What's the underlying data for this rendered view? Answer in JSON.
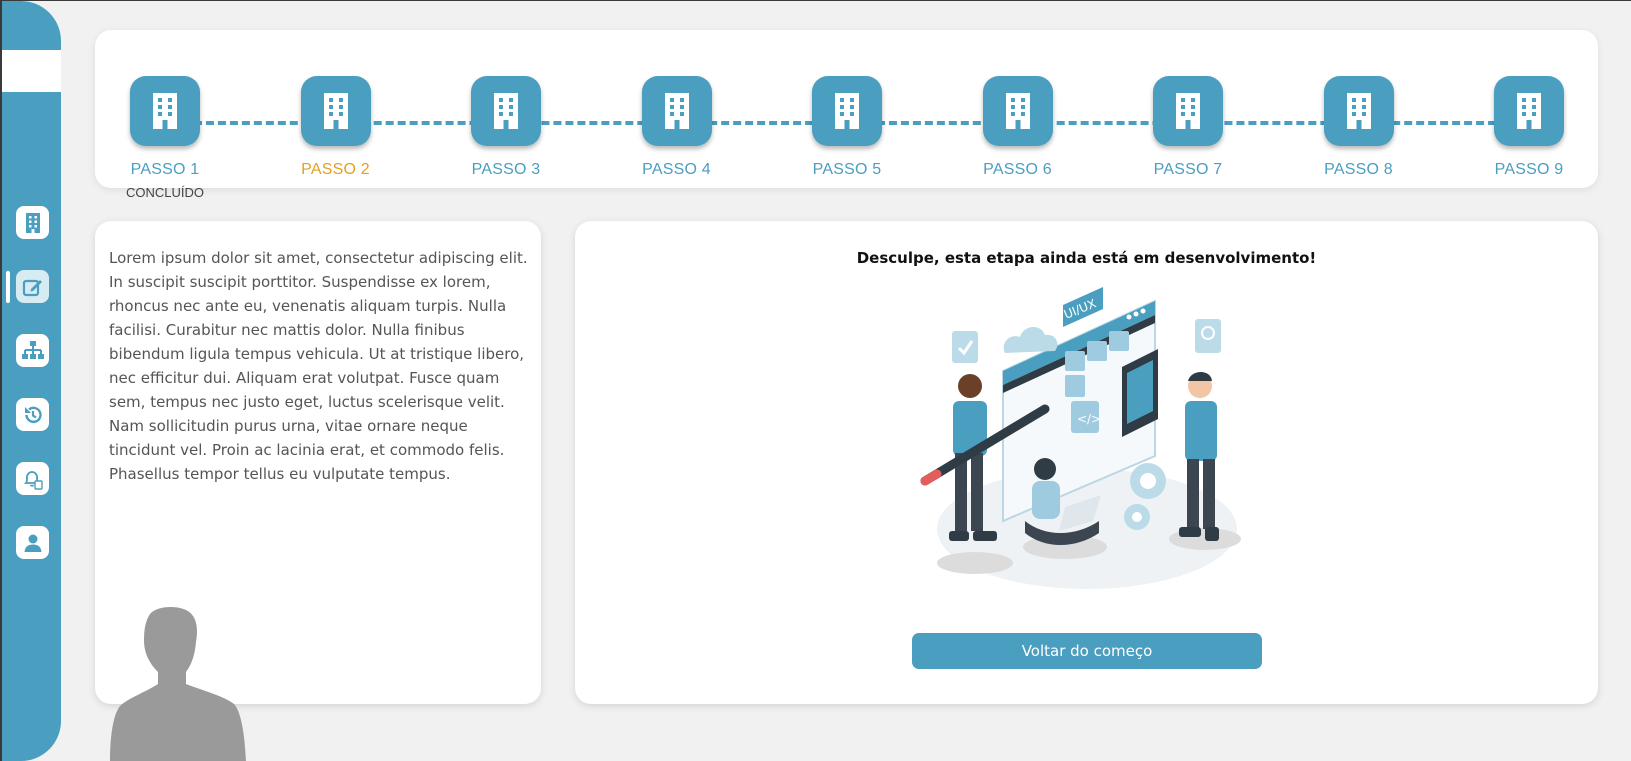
{
  "sidebar": {
    "items": [
      {
        "icon": "building-icon"
      },
      {
        "icon": "edit-icon",
        "active": true
      },
      {
        "icon": "org-chart-icon"
      },
      {
        "icon": "history-icon"
      },
      {
        "icon": "bell-document-icon"
      },
      {
        "icon": "user-icon"
      }
    ]
  },
  "stepper": {
    "steps": [
      {
        "label": "PASSO 1",
        "status": "CONCLUÍDO"
      },
      {
        "label": "PASSO 2",
        "current": true
      },
      {
        "label": "PASSO 3"
      },
      {
        "label": "PASSO 4"
      },
      {
        "label": "PASSO 5"
      },
      {
        "label": "PASSO 6"
      },
      {
        "label": "PASSO 7"
      },
      {
        "label": "PASSO 8"
      },
      {
        "label": "PASSO 9"
      }
    ]
  },
  "info_panel": {
    "text": "Lorem ipsum dolor sit amet, consectetur adipiscing elit. In suscipit suscipit porttitor. Suspendisse ex lorem, rhoncus nec ante eu, venenatis aliquam turpis. Nulla facilisi. Curabitur nec mattis dolor. Nulla finibus bibendum ligula tempus vehicula. Ut at tristique libero, nec efficitur dui. Aliquam erat volutpat. Fusce quam sem, tempus nec justo eget, luctus scelerisque velit. Nam sollicitudin purus urna, vitae ornare neque tincidunt vel. Proin ac lacinia erat, et commodo felis. Phasellus tempor tellus eu vulputate tempus."
  },
  "main_panel": {
    "title": "Desculpe, esta etapa ainda está em desenvolvimento!",
    "illustration_label": "UI/UX",
    "back_button": "Voltar do começo"
  },
  "colors": {
    "primary": "#4a9ec0",
    "current_step": "#e6a01d",
    "background": "#f1f1f1"
  }
}
